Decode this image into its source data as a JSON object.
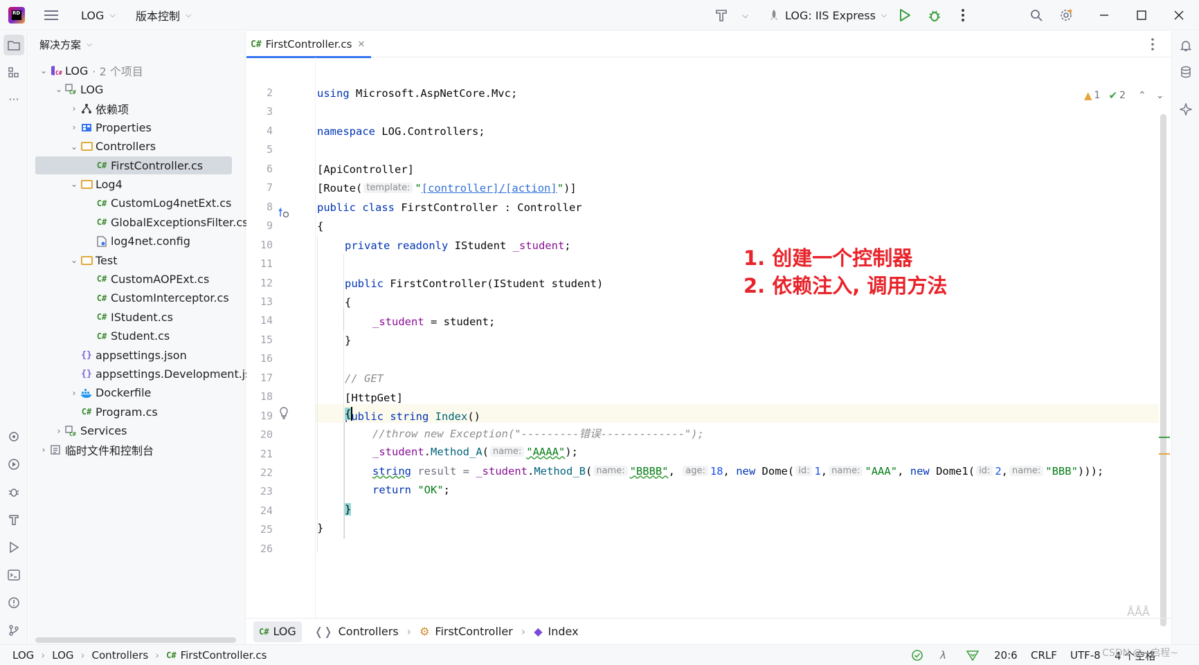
{
  "titlebar": {
    "project_menu": "LOG",
    "vcs_menu": "版本控制",
    "run_config": "LOG: IIS Express"
  },
  "panel": {
    "title": "解决方案",
    "tree": [
      {
        "label": "LOG",
        "suffix": "· 2 个项目",
        "icon": "solution-icon",
        "arrow": "⌄",
        "indent": 0
      },
      {
        "label": "LOG",
        "icon": "project-icon",
        "arrow": "⌄",
        "indent": 1
      },
      {
        "label": "依赖项",
        "icon": "dependencies-icon",
        "arrow": "›",
        "indent": 2
      },
      {
        "label": "Properties",
        "icon": "properties-icon",
        "arrow": "›",
        "indent": 2
      },
      {
        "label": "Controllers",
        "icon": "folder-icon",
        "arrow": "⌄",
        "indent": 2
      },
      {
        "label": "FirstController.cs",
        "icon": "csharp-file-icon",
        "arrow": "",
        "indent": 3,
        "selected": true
      },
      {
        "label": "Log4",
        "icon": "folder-icon",
        "arrow": "⌄",
        "indent": 2
      },
      {
        "label": "CustomLog4netExt.cs",
        "icon": "csharp-file-icon",
        "arrow": "",
        "indent": 3
      },
      {
        "label": "GlobalExceptionsFilter.cs",
        "icon": "csharp-file-icon",
        "arrow": "",
        "indent": 3
      },
      {
        "label": "log4net.config",
        "icon": "config-file-icon",
        "arrow": "",
        "indent": 3
      },
      {
        "label": "Test",
        "icon": "folder-icon",
        "arrow": "⌄",
        "indent": 2
      },
      {
        "label": "CustomAOPExt.cs",
        "icon": "csharp-file-icon",
        "arrow": "",
        "indent": 3
      },
      {
        "label": "CustomInterceptor.cs",
        "icon": "csharp-file-icon",
        "arrow": "",
        "indent": 3
      },
      {
        "label": "IStudent.cs",
        "icon": "csharp-file-icon",
        "arrow": "",
        "indent": 3
      },
      {
        "label": "Student.cs",
        "icon": "csharp-file-icon",
        "arrow": "",
        "indent": 3
      },
      {
        "label": "appsettings.json",
        "icon": "json-file-icon",
        "arrow": "",
        "indent": 2
      },
      {
        "label": "appsettings.Development.json",
        "icon": "json-file-icon",
        "arrow": "",
        "indent": 2
      },
      {
        "label": "Dockerfile",
        "icon": "docker-icon",
        "arrow": "›",
        "indent": 2
      },
      {
        "label": "Program.cs",
        "icon": "csharp-file-icon",
        "arrow": "",
        "indent": 2
      },
      {
        "label": "Services",
        "icon": "project-icon",
        "arrow": "›",
        "indent": 1
      },
      {
        "label": "临时文件和控制台",
        "icon": "scratches-icon",
        "arrow": "›",
        "indent": 0
      }
    ]
  },
  "editor": {
    "tab_label": "FirstController.cs",
    "tab_icon": "C#",
    "warnings": "1",
    "ok_count": "2",
    "line_numbers": [
      "2",
      "3",
      "4",
      "5",
      "6",
      "7",
      "8",
      "9",
      "10",
      "11",
      "12",
      "13",
      "14",
      "15",
      "16",
      "17",
      "18",
      "19",
      "20",
      "21",
      "22",
      "23",
      "24",
      "25",
      "26"
    ],
    "annotation_line1": "1. 创建一个控制器",
    "annotation_line2": "2. 依赖注入, 调用方法",
    "code": {
      "l2_kw": "using",
      "l2_rest": " Microsoft.AspNetCore.Mvc;",
      "l4_kw": "namespace",
      "l4_rest": " LOG.Controllers;",
      "l6": "[ApiController]",
      "l7_a": "[Route(",
      "l7_hint": "template:",
      "l7_q1": "\"",
      "l7_link": "[controller]/[action]",
      "l7_q2": "\"",
      "l7_b": ")]",
      "l8_kw": "public class",
      "l8_rest": " FirstController : Controller",
      "l9": "{",
      "l10_kw": "private readonly",
      "l10_ty": " IStudent ",
      "l10_fld": "_student",
      "l10_end": ";",
      "l12_kw": "public",
      "l12_rest": " FirstController(IStudent student)",
      "l13": "{",
      "l14_fld": "_student",
      "l14_rest": " = student;",
      "l15": "}",
      "l17": "// GET",
      "l18": "[HttpGet]",
      "l19_kw": "public string",
      "l19_mth": " Index",
      "l19_rest": "()",
      "l20": "{",
      "l21": "//throw new Exception(\"---------错误-------------\");",
      "l22_fld": "_student",
      "l22_dot": ".",
      "l22_mth": "Method_A",
      "l22_p": "(",
      "l22_hint": "name:",
      "l22_str": "\"AAAA\"",
      "l22_end": ");",
      "l23_kw": "string",
      "l23_var": " result = ",
      "l23_fld": "_student",
      "l23_dot": ".",
      "l23_mth": "Method_B",
      "l23_p": "(",
      "l23_h1": "name:",
      "l23_s1": "\"BBBB\"",
      "l23_c1": ", ",
      "l23_h2": "age:",
      "l23_n1": "18",
      "l23_c2": ", ",
      "l23_new1": "new",
      "l23_t1": " Dome(",
      "l23_h3": "id:",
      "l23_n2": "1",
      "l23_c3": ",",
      "l23_h4": "name:",
      "l23_s2": "\"AAA\"",
      "l23_c4": ", ",
      "l23_new2": "new",
      "l23_t2": " Dome1(",
      "l23_h5": "id:",
      "l23_n3": "2",
      "l23_c5": ",",
      "l23_h6": "name:",
      "l23_s3": "\"BBB\"",
      "l23_end": ")));",
      "l24_kw": "return",
      "l24_str": " \"OK\"",
      "l24_end": ";",
      "l25": "}",
      "l26": "}"
    }
  },
  "breadcrumb_bottom": {
    "project": "LOG",
    "namespace": "Controllers",
    "class": "FirstController",
    "method": "Index"
  },
  "statusbar": {
    "crumbs": [
      "LOG",
      "LOG",
      "Controllers",
      "FirstController.cs"
    ],
    "position": "20:6",
    "line_ending": "CRLF",
    "encoding": "UTF-8",
    "indent": "4 个空格"
  },
  "watermark": "CSDN @~启程~",
  "colors": {
    "accent": "#3574f0",
    "annotation": "#e8232a",
    "keyword": "#0033b3",
    "string": "#067d17",
    "field": "#871094"
  }
}
